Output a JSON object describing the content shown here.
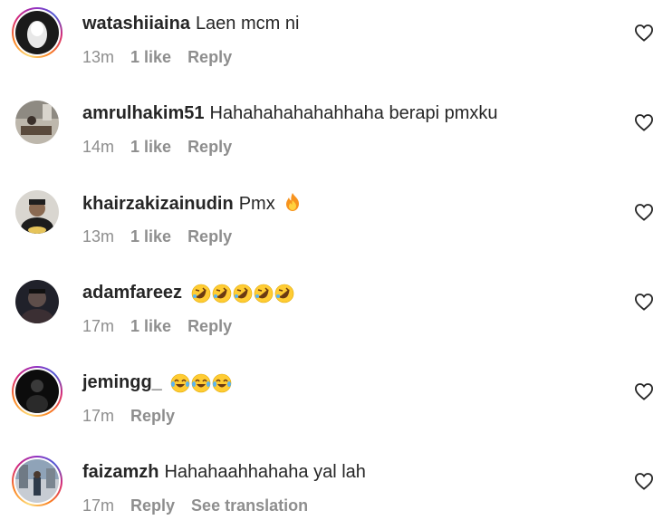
{
  "comments": [
    {
      "username": "watashiiaina",
      "text": "Laen mcm ni",
      "time": "13m",
      "likes": "1 like",
      "reply": "Reply"
    },
    {
      "username": "amrulhakim51",
      "text": "Hahahahahahahhaha berapi pmxku",
      "time": "14m",
      "likes": "1 like",
      "reply": "Reply"
    },
    {
      "username": "khairzakizainudin",
      "text": "Pmx",
      "time": "13m",
      "likes": "1 like",
      "reply": "Reply"
    },
    {
      "username": "adamfareez",
      "text": "",
      "time": "17m",
      "likes": "1 like",
      "reply": "Reply"
    },
    {
      "username": "jemingg_",
      "text": "",
      "time": "17m",
      "reply": "Reply"
    },
    {
      "username": "faizamzh",
      "text": "Hahahaahhahaha yal lah",
      "time": "17m",
      "reply": "Reply",
      "translate": "See translation"
    }
  ],
  "icons": {
    "heart": "heart-outline-icon",
    "fire": "fire-emoji",
    "rofl": "rolling-on-floor-laughing-emoji",
    "joy": "face-with-tears-of-joy-emoji"
  },
  "colors": {
    "username": "#262626",
    "meta": "#8e8e8e",
    "story_ring": "#d62976"
  }
}
